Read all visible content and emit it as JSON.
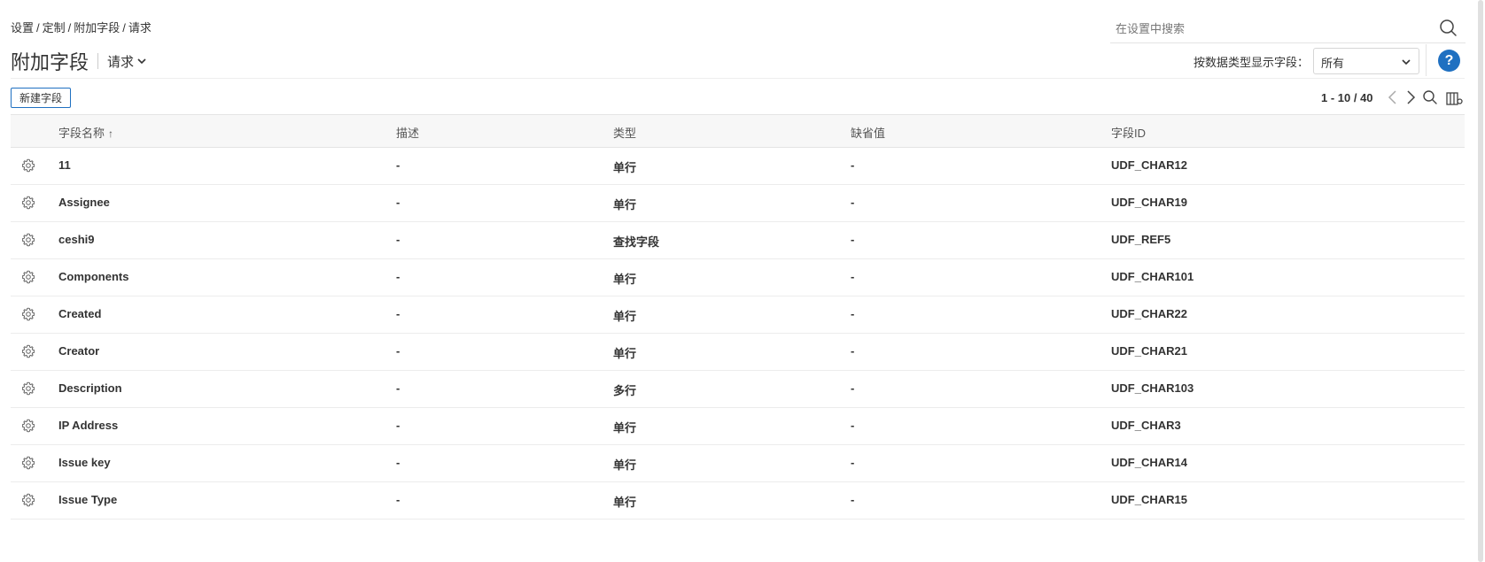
{
  "breadcrumb": {
    "items": [
      "设置",
      "定制",
      "附加字段",
      "请求"
    ]
  },
  "search": {
    "placeholder": "在设置中搜索"
  },
  "header": {
    "title": "附加字段",
    "module": "请求",
    "filter_label": "按数据类型显示字段：",
    "filter_value": "所有",
    "help_label": "?"
  },
  "toolbar": {
    "new_button_label": "新建字段",
    "pagination": "1 - 10 / 40"
  },
  "table": {
    "columns": {
      "name": "字段名称",
      "description": "描述",
      "type": "类型",
      "default": "缺省值",
      "field_id": "字段ID"
    },
    "sort_indicator": "↑",
    "rows": [
      {
        "name": "11",
        "description": "-",
        "type": "单行",
        "default": "-",
        "field_id": "UDF_CHAR12"
      },
      {
        "name": "Assignee",
        "description": "-",
        "type": "单行",
        "default": "-",
        "field_id": "UDF_CHAR19"
      },
      {
        "name": "ceshi9",
        "description": "-",
        "type": "查找字段",
        "default": "-",
        "field_id": "UDF_REF5"
      },
      {
        "name": "Components",
        "description": "-",
        "type": "单行",
        "default": "-",
        "field_id": "UDF_CHAR101"
      },
      {
        "name": "Created",
        "description": "-",
        "type": "单行",
        "default": "-",
        "field_id": "UDF_CHAR22"
      },
      {
        "name": "Creator",
        "description": "-",
        "type": "单行",
        "default": "-",
        "field_id": "UDF_CHAR21"
      },
      {
        "name": "Description",
        "description": "-",
        "type": "多行",
        "default": "-",
        "field_id": "UDF_CHAR103"
      },
      {
        "name": "IP Address",
        "description": "-",
        "type": "单行",
        "default": "-",
        "field_id": "UDF_CHAR3"
      },
      {
        "name": "Issue key",
        "description": "-",
        "type": "单行",
        "default": "-",
        "field_id": "UDF_CHAR14"
      },
      {
        "name": "Issue Type",
        "description": "-",
        "type": "单行",
        "default": "-",
        "field_id": "UDF_CHAR15"
      }
    ]
  },
  "icons": {
    "search": "search-icon",
    "module_dropdown": "chevron-down-icon",
    "filter_dropdown": "chevron-down-icon",
    "prev": "chevron-left-icon",
    "next": "chevron-right-icon",
    "table_search": "search-icon",
    "column_settings": "column-settings-icon",
    "row_action": "gear-icon"
  },
  "colors": {
    "accent": "#1f70c1",
    "header_bg": "#f7f7f7",
    "text": "#333333",
    "border": "#e4e4e4"
  }
}
